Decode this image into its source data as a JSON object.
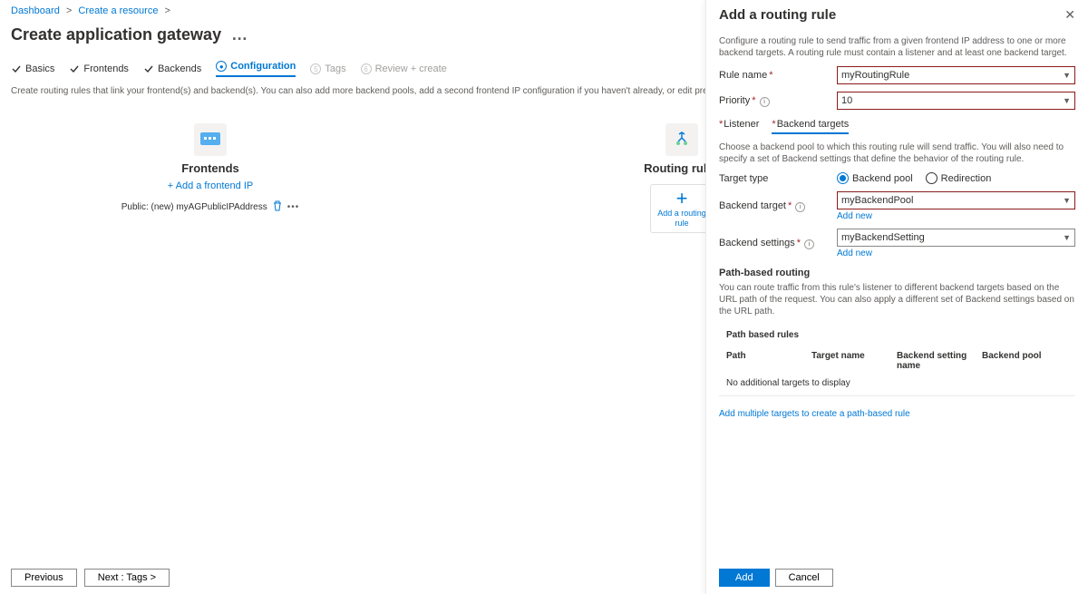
{
  "breadcrumb": {
    "dashboard": "Dashboard",
    "create_resource": "Create a resource"
  },
  "page": {
    "title": "Create application gateway"
  },
  "tabs": {
    "basics": "Basics",
    "frontends": "Frontends",
    "backends": "Backends",
    "configuration": "Configuration",
    "tags": "Tags",
    "review": "Review + create",
    "tags_num": "5",
    "review_num": "6"
  },
  "desc": "Create routing rules that link your frontend(s) and backend(s). You can also add more backend pools, add a second frontend IP configuration if you haven't already, or edit previous configurations.",
  "frontends": {
    "title": "Frontends",
    "add_link": "+ Add a frontend IP",
    "ip_label": "Public: (new) myAGPublicIPAddress"
  },
  "routing": {
    "title": "Routing rules",
    "add_label": "Add a routing rule"
  },
  "buttons": {
    "previous": "Previous",
    "next": "Next : Tags >"
  },
  "panel": {
    "title": "Add a routing rule",
    "desc": "Configure a routing rule to send traffic from a given frontend IP address to one or more backend targets. A routing rule must contain a listener and at least one backend target.",
    "rule_name_label": "Rule name",
    "rule_name_value": "myRoutingRule",
    "priority_label": "Priority",
    "priority_value": "10",
    "tab_listener": "Listener",
    "tab_backend": "Backend targets",
    "tab_desc": "Choose a backend pool to which this routing rule will send traffic. You will also need to specify a set of Backend settings that define the behavior of the routing rule.",
    "target_type_label": "Target type",
    "target_type_pool": "Backend pool",
    "target_type_redir": "Redirection",
    "backend_target_label": "Backend target",
    "backend_target_value": "myBackendPool",
    "backend_settings_label": "Backend settings",
    "backend_settings_value": "myBackendSetting",
    "add_new": "Add new",
    "path_title": "Path-based routing",
    "path_desc": "You can route traffic from this rule's listener to different backend targets based on the URL path of the request. You can also apply a different set of Backend settings based on the URL path.",
    "path_table_title": "Path based rules",
    "col_path": "Path",
    "col_target": "Target name",
    "col_setting": "Backend setting name",
    "col_pool": "Backend pool",
    "path_empty": "No additional targets to display",
    "add_multiple": "Add multiple targets to create a path-based rule",
    "btn_add": "Add",
    "btn_cancel": "Cancel"
  }
}
